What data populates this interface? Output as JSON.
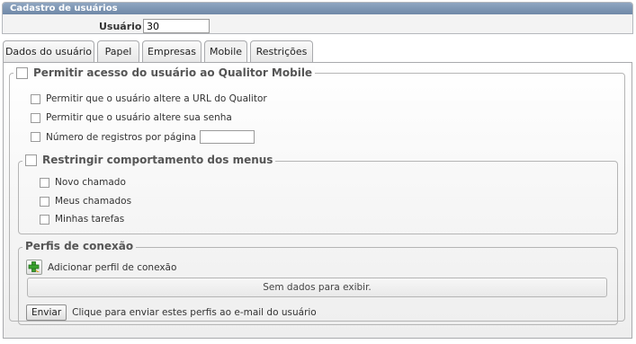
{
  "header": {
    "title": "Cadastro de usuários",
    "user_label": "Usuário :",
    "user_value": "30"
  },
  "tabs": [
    {
      "label": "Dados do usuário"
    },
    {
      "label": "Papel"
    },
    {
      "label": "Empresas"
    },
    {
      "label": "Mobile"
    },
    {
      "label": "Restrições"
    }
  ],
  "active_tab": "Mobile",
  "mobile": {
    "title": "Permitir acesso do usuário ao Qualitor Mobile",
    "options": [
      {
        "label": "Permitir que o usuário altere a URL do Qualitor"
      },
      {
        "label": "Permitir que o usuário altere sua senha"
      },
      {
        "label": "Número de registros por página"
      }
    ],
    "records_value": ""
  },
  "menus": {
    "title": "Restringir comportamento dos menus",
    "options": [
      {
        "label": "Novo chamado"
      },
      {
        "label": "Meus chamados"
      },
      {
        "label": "Minhas tarefas"
      }
    ]
  },
  "profiles": {
    "title": "Perfis de conexão",
    "add_label": "Adicionar perfil de conexão",
    "empty_text": "Sem dados para exibir.",
    "send_button": "Enviar",
    "send_hint": "Clique para enviar estes perfis ao e-mail do usuário"
  }
}
